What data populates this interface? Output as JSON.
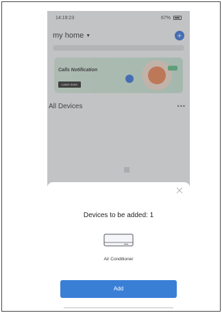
{
  "status_bar": {
    "time": "14:19:23",
    "battery": "67%"
  },
  "home": {
    "title": "my home",
    "add_icon": "plus-icon"
  },
  "banner": {
    "title": "Calls Notification",
    "button_label": "Learn more"
  },
  "devices_section": {
    "title": "All Devices",
    "more_icon": "more-icon"
  },
  "sheet": {
    "title": "Devices to be added: 1",
    "device_name": "Air Conditioner",
    "device_icon": "air-conditioner-icon",
    "close_icon": "close-icon",
    "add_label": "Add"
  },
  "colors": {
    "primary": "#3a7fd6",
    "accent": "#1a5fd6"
  }
}
